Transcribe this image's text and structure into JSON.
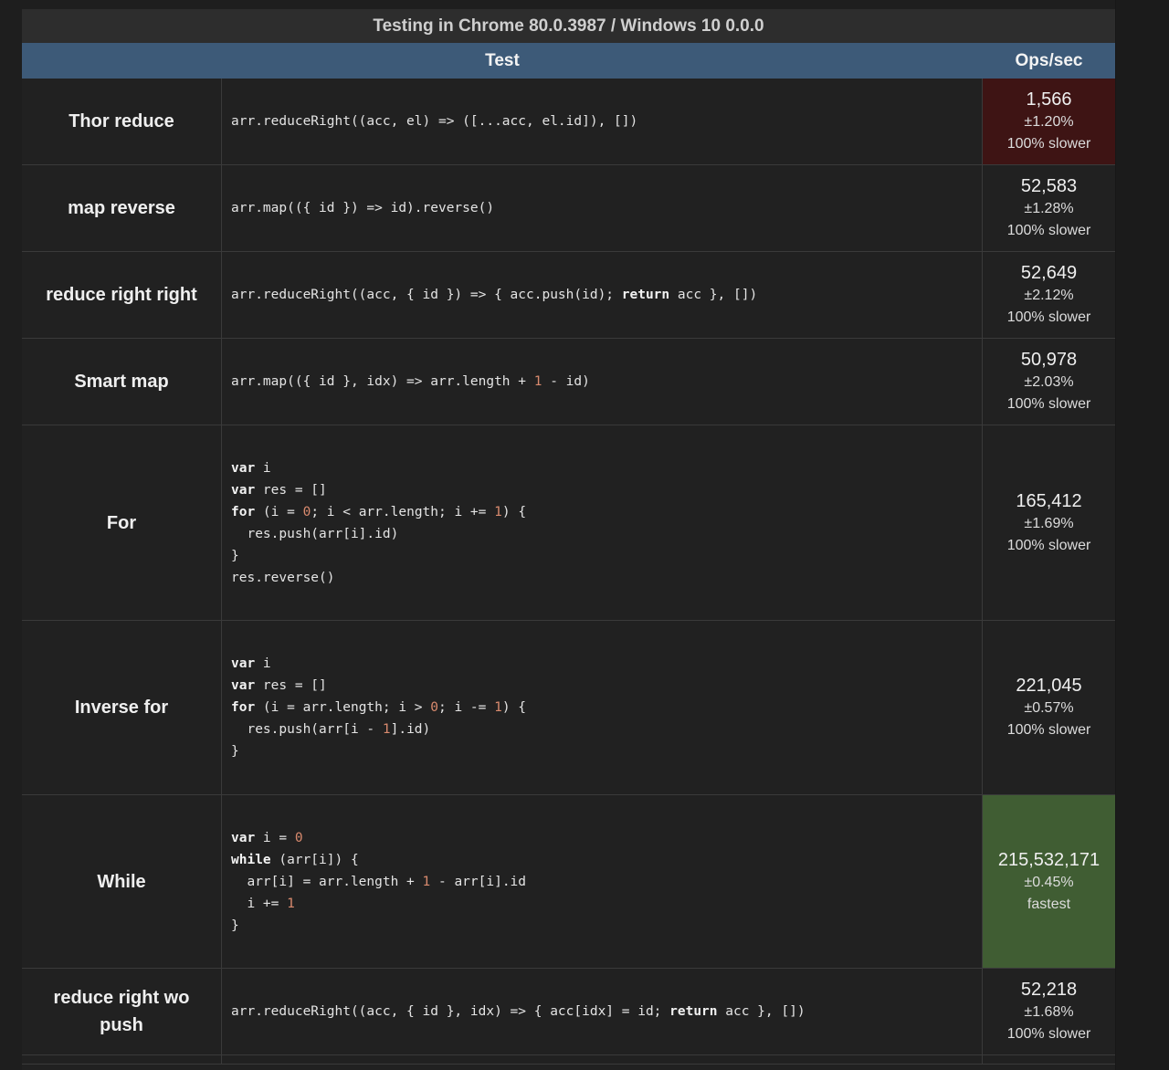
{
  "title": "Testing in Chrome 80.0.3987 / Windows 10 0.0.0",
  "columns": {
    "test": "Test",
    "ops": "Ops/sec"
  },
  "colors": {
    "slowest": "#3e1414",
    "fastest": "#405d33",
    "header": "#3d5a78",
    "keyword": "#f2f2f2",
    "number": "#d98a6e"
  },
  "rows": [
    {
      "name": "Thor reduce",
      "code": [
        "arr.reduceRight((acc, el) => ([...acc, el.id]), [])"
      ],
      "ops": "1,566",
      "rme": "±1.20%",
      "note": "100% slower",
      "status": "slowest"
    },
    {
      "name": "map reverse",
      "code": [
        "arr.map(({ id }) => id).reverse()"
      ],
      "ops": "52,583",
      "rme": "±1.28%",
      "note": "100% slower",
      "status": ""
    },
    {
      "name": "reduce right right",
      "code": [
        "arr.reduceRight((acc, { id }) => { acc.push(id); return acc }, [])"
      ],
      "ops": "52,649",
      "rme": "±2.12%",
      "note": "100% slower",
      "status": ""
    },
    {
      "name": "Smart map",
      "code": [
        "arr.map(({ id }, idx) => arr.length + 1 - id)"
      ],
      "ops": "50,978",
      "rme": "±2.03%",
      "note": "100% slower",
      "status": ""
    },
    {
      "name": "For",
      "code": [
        "var i",
        "var res = []",
        "for (i = 0; i < arr.length; i += 1) {",
        "  res.push(arr[i].id)",
        "}",
        "res.reverse()"
      ],
      "ops": "165,412",
      "rme": "±1.69%",
      "note": "100% slower",
      "status": ""
    },
    {
      "name": "Inverse for",
      "code": [
        "var i",
        "var res = []",
        "for (i = arr.length; i > 0; i -= 1) {",
        "  res.push(arr[i - 1].id)",
        "}"
      ],
      "ops": "221,045",
      "rme": "±0.57%",
      "note": "100% slower",
      "status": ""
    },
    {
      "name": "While",
      "code": [
        "var i = 0",
        "while (arr[i]) {",
        "  arr[i] = arr.length + 1 - arr[i].id",
        "  i += 1",
        "}"
      ],
      "ops": "215,532,171",
      "rme": "±0.45%",
      "note": "fastest",
      "status": "fastest"
    },
    {
      "name": "reduce right wo push",
      "code": [
        "arr.reduceRight((acc, { id }, idx) => { acc[idx] = id; return acc }, [])"
      ],
      "ops": "52,218",
      "rme": "±1.68%",
      "note": "100% slower",
      "status": ""
    }
  ]
}
